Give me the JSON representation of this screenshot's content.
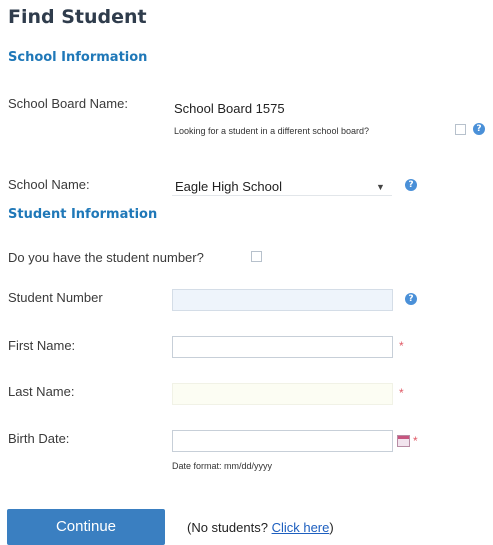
{
  "page_title": "Find Student",
  "school_section": {
    "heading": "School Information",
    "board_label": "School Board Name:",
    "board_value": "School Board 1575",
    "different_board_text": "Looking for a student in a different school board?",
    "school_label": "School Name:",
    "school_value": "Eagle High School"
  },
  "student_section": {
    "heading": "Student Information",
    "have_number_label": "Do you have the student number?",
    "student_number_label": "Student Number",
    "first_name_label": "First Name:",
    "last_name_label": "Last Name:",
    "birth_date_label": "Birth Date:",
    "date_format_hint": "Date format: mm/dd/yyyy",
    "required_mark": "*"
  },
  "footer": {
    "continue_label": "Continue",
    "no_students_prefix": "(No students?",
    "click_here": "Click here",
    "no_students_suffix": ")"
  },
  "icons": {
    "help": "help-icon",
    "calendar": "calendar-icon",
    "dropdown": "chevron-down-icon"
  },
  "colors": {
    "title": "#2f3c4c",
    "section_heading": "#1f78b8",
    "help_icon": "#4a90d8",
    "required": "#e05a66",
    "button": "#3a7fc1",
    "link": "#1d5fbf"
  }
}
